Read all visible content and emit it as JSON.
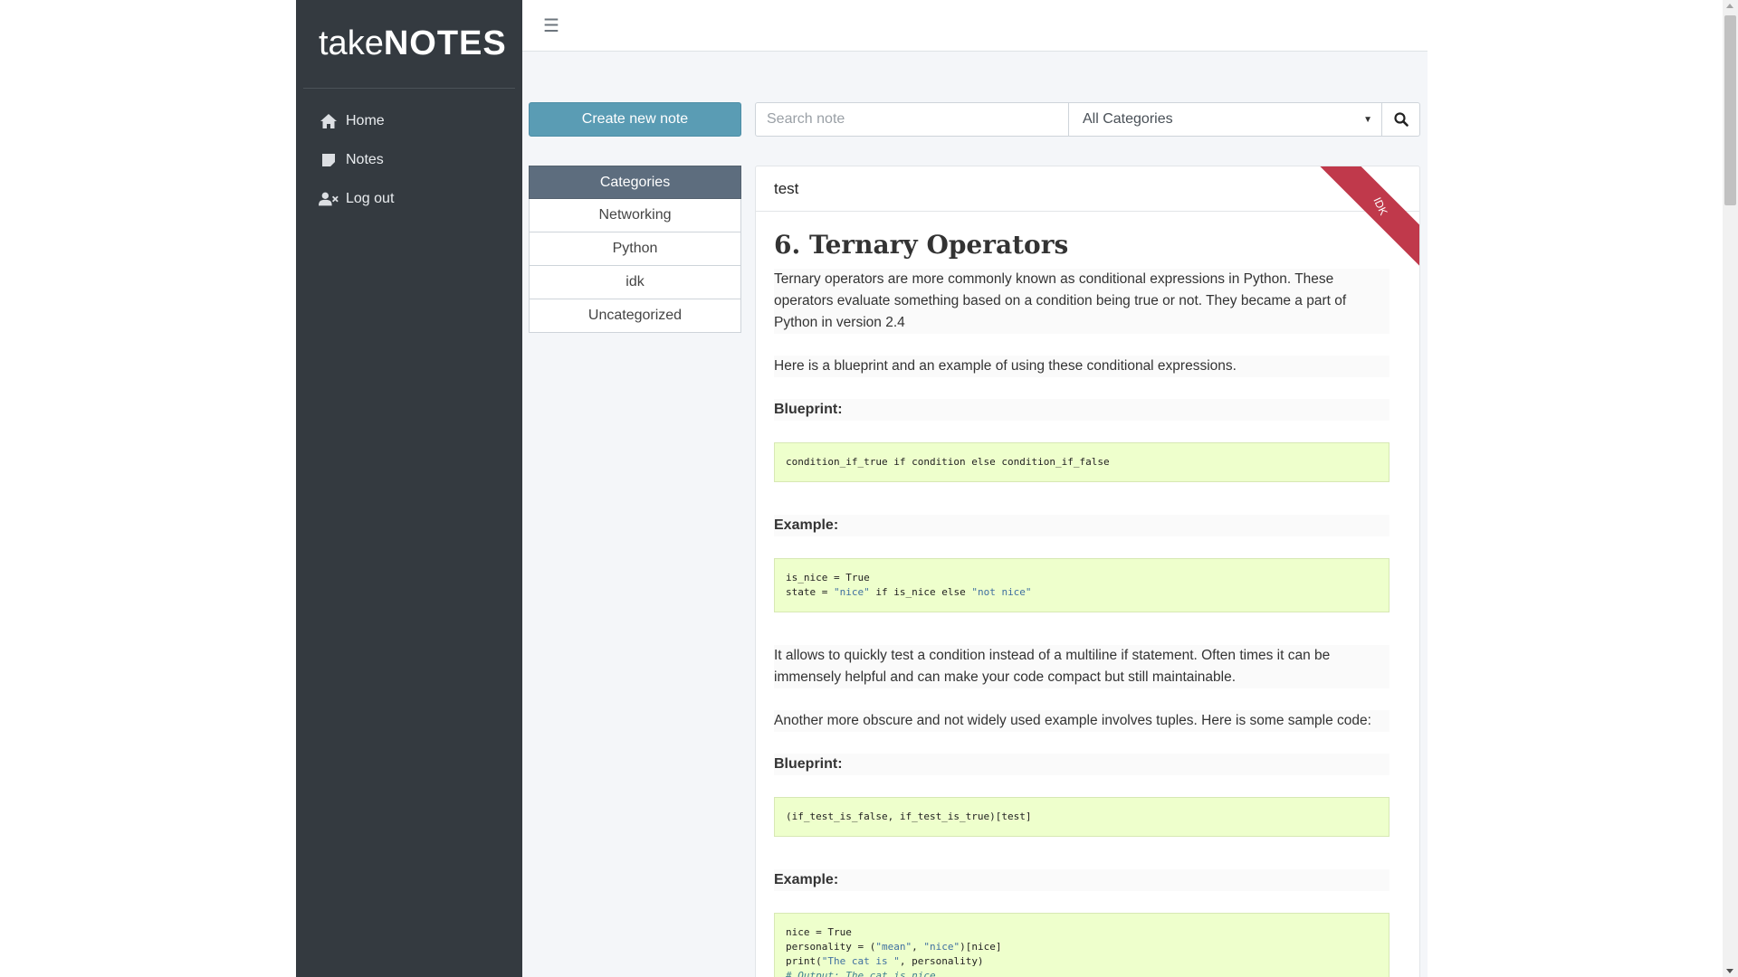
{
  "brand": {
    "light": "take",
    "bold": "NOTES"
  },
  "nav": {
    "home": "Home",
    "notes": "Notes",
    "logout": "Log out"
  },
  "toolbar": {
    "create_label": "Create new note",
    "search_placeholder": "Search note",
    "category_selected": "All Categories"
  },
  "categories": {
    "header": "Categories",
    "items": [
      "Networking",
      "Python",
      "idk",
      "Uncategorized"
    ]
  },
  "note": {
    "name": "test",
    "badge": "IDK",
    "title": "6. Ternary Operators",
    "p1": "Ternary operators are more commonly known as conditional expressions in Python. These operators evaluate something based on a condition being true or not. They became a part of Python in version 2.4",
    "p2": "Here is a blueprint and an example of using these conditional expressions.",
    "blueprint_label": "Blueprint:",
    "example_label": "Example:",
    "code1": "condition_if_true if condition else condition_if_false",
    "code2_line1": "is_nice = True",
    "code2_line2_a": "state = ",
    "code2_line2_b": "\"nice\"",
    "code2_line2_c": " if is_nice else ",
    "code2_line2_d": "\"not nice\"",
    "p3": "It allows to quickly test a condition instead of a multiline if statement. Often times it can be immensely helpful and can make your code compact but still maintainable.",
    "p4": "Another more obscure and not widely used example involves tuples. Here is some sample code:",
    "code3": "(if_test_is_false, if_test_is_true)[test]",
    "code4_line1": "nice = True",
    "code4_line2_a": "personality = (",
    "code4_line2_b": "\"mean\"",
    "code4_line2_c": ", ",
    "code4_line2_d": "\"nice\"",
    "code4_line2_e": ")[nice]",
    "code4_line3_a": "print(",
    "code4_line3_b": "\"The cat is \"",
    "code4_line3_c": ", personality)",
    "code4_line4": "# Output: The cat is nice"
  },
  "colors": {
    "sidebar": "#343a40",
    "primary_button": "#5a9cb4",
    "category_header": "#5d6d7e",
    "ribbon": "#c0394b",
    "code_bg": "#eeffcc"
  }
}
